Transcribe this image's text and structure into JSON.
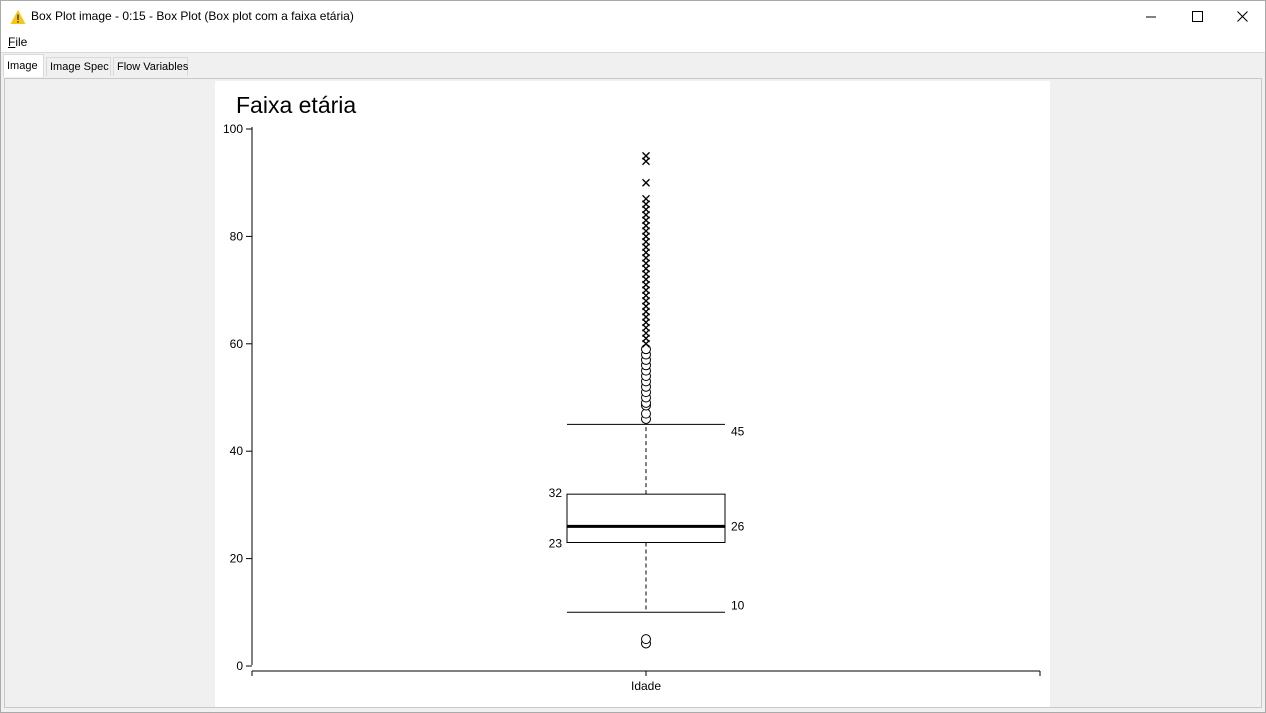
{
  "window": {
    "title": "Box Plot image - 0:15 - Box Plot (Box plot com a faixa etária)",
    "icon": "warning-triangle-icon",
    "controls": [
      "minimize-icon",
      "maximize-icon",
      "close-icon"
    ]
  },
  "menu": {
    "items": [
      {
        "label": "File",
        "mnemonic": "F",
        "rest": "ile"
      }
    ]
  },
  "tabs": [
    {
      "label": "Image",
      "active": true
    },
    {
      "label": "Image Spec",
      "active": false
    },
    {
      "label": "Flow Variables",
      "active": false
    }
  ],
  "colors": {
    "accent_icon": "#f5c518"
  },
  "chart_data": {
    "type": "boxplot",
    "title": "Faixa etária",
    "xlabel": "",
    "ylabel": "",
    "category": "Idade",
    "ylim": [
      0,
      100
    ],
    "yticks": [
      0,
      20,
      40,
      60,
      80,
      100
    ],
    "grid": false,
    "stats": {
      "lower_whisker": 10,
      "q1": 23,
      "median": 26,
      "q3": 32,
      "upper_whisker": 45
    },
    "labels": {
      "lower_whisker": "10",
      "q1": "23",
      "median": "26",
      "q3": "32",
      "upper_whisker": "45"
    },
    "mild_outliers": [
      4.2,
      5.0,
      46.0,
      47.0,
      48.5,
      49.0,
      50.0,
      51.0,
      52.0,
      53.0,
      54.0,
      55.0,
      56.0,
      57.0,
      58.0,
      59.0
    ],
    "extreme_outliers": [
      60,
      61,
      62,
      63,
      64,
      65,
      66,
      67,
      68,
      69,
      70,
      71,
      72,
      73,
      74,
      75,
      76,
      77,
      78,
      79,
      80,
      81,
      82,
      83,
      84,
      85,
      86,
      87,
      90,
      94,
      95
    ]
  }
}
